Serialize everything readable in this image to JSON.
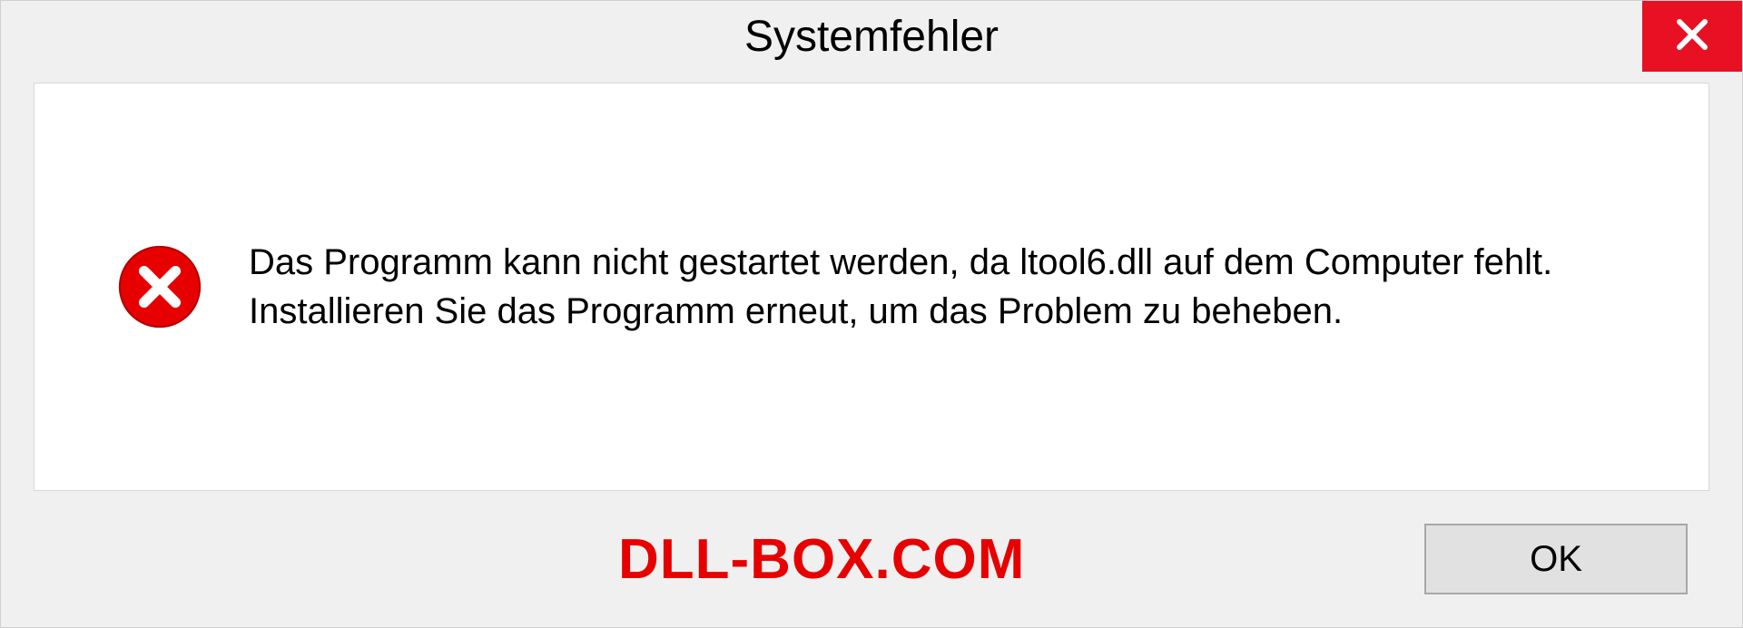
{
  "dialog": {
    "title": "Systemfehler",
    "message": "Das Programm kann nicht gestartet werden, da ltool6.dll auf dem Computer fehlt. Installieren Sie das Programm erneut, um das Problem zu beheben.",
    "ok_label": "OK"
  },
  "watermark": "DLL-BOX.COM"
}
